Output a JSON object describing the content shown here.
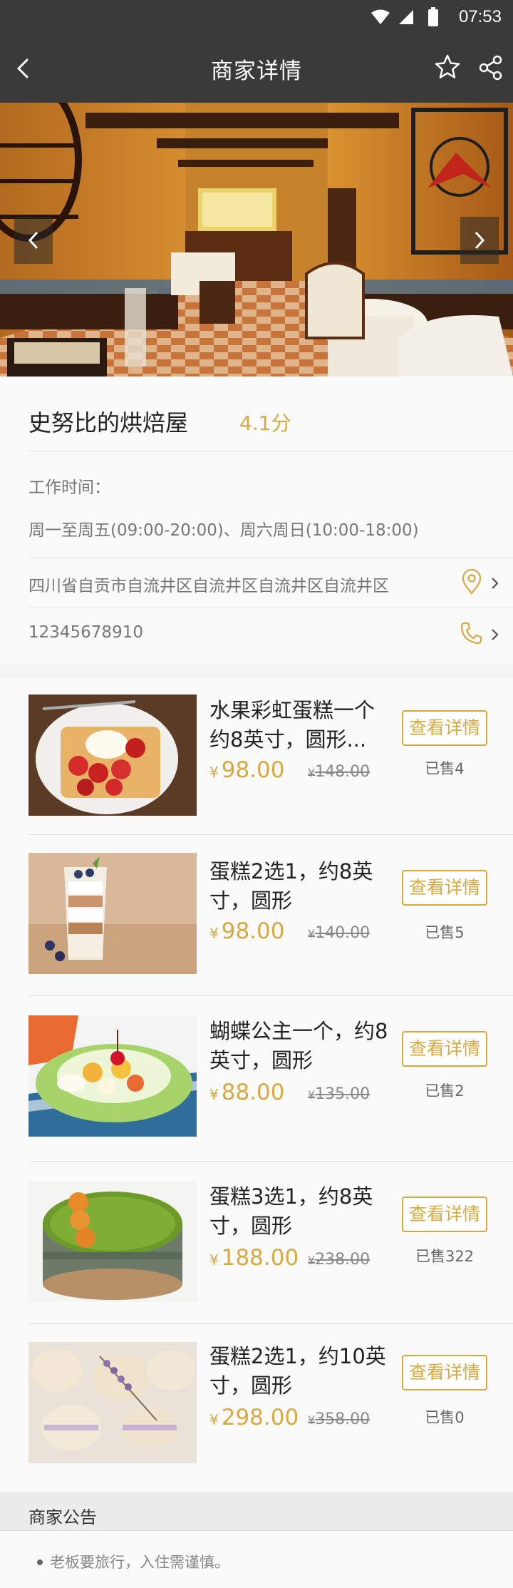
{
  "status_bar": {
    "time": "07:53"
  },
  "nav": {
    "title": "商家详情"
  },
  "shop": {
    "name": "史努比的烘焙屋",
    "rating": "4.1分",
    "hours_label": "工作时间：",
    "hours": "周一至周五(09:00-20:00)、周六周日(10:00-18:00)",
    "address": "四川省自贡市自流井区自流井区自流井区自流井区",
    "phone": "12345678910"
  },
  "products": [
    {
      "name": "水果彩虹蛋糕一个约8英寸，圆形...",
      "currency": "¥",
      "price": "98.00",
      "orig_currency": "¥",
      "orig_price": "148.00",
      "button": "查看详情",
      "sold": "已售4"
    },
    {
      "name": "蛋糕2选1，约8英寸，圆形",
      "currency": "¥",
      "price": "98.00",
      "orig_currency": "¥",
      "orig_price": "140.00",
      "button": "查看详情",
      "sold": "已售5"
    },
    {
      "name": "蝴蝶公主一个，约8英寸，圆形",
      "currency": "¥",
      "price": "88.00",
      "orig_currency": "¥",
      "orig_price": "135.00",
      "button": "查看详情",
      "sold": "已售2"
    },
    {
      "name": "蛋糕3选1，约8英寸，圆形",
      "currency": "¥",
      "price": "188.00",
      "orig_currency": "¥",
      "orig_price": "238.00",
      "button": "查看详情",
      "sold": "已售322"
    },
    {
      "name": "蛋糕2选1，约10英寸，圆形",
      "currency": "¥",
      "price": "298.00",
      "orig_currency": "¥",
      "orig_price": "358.00",
      "button": "查看详情",
      "sold": "已售0"
    }
  ],
  "notice": {
    "title": "商家公告",
    "items": [
      "老板要旅行，入住需谨慎。"
    ]
  },
  "colors": {
    "accent": "#d8a841",
    "header_bg": "#3a3a3a"
  },
  "icons": [
    "back-icon",
    "star-icon",
    "share-icon",
    "wifi-icon",
    "signal-icon",
    "battery-icon",
    "location-pin-icon",
    "phone-icon",
    "chevron-right-icon"
  ]
}
